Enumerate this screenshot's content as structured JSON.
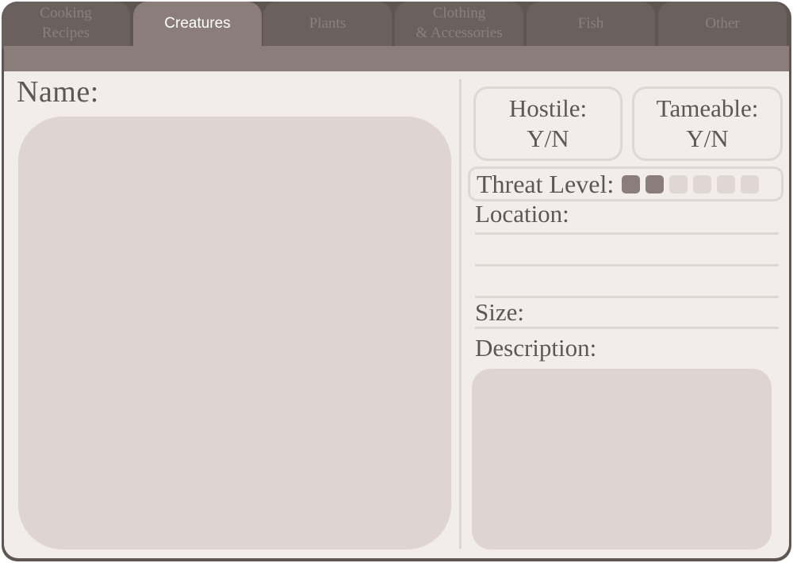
{
  "tabs": [
    {
      "label": "Cooking\nRecipes",
      "active": false
    },
    {
      "label": "Creatures",
      "active": true
    },
    {
      "label": "Plants",
      "active": false
    },
    {
      "label": "Clothing\n& Accessories",
      "active": false
    },
    {
      "label": "Fish",
      "active": false
    },
    {
      "label": "Other",
      "active": false
    }
  ],
  "form": {
    "name_label": "Name:",
    "hostile": {
      "label": "Hostile:",
      "value": "Y/N"
    },
    "tameable": {
      "label": "Tameable:",
      "value": "Y/N"
    },
    "threat": {
      "label": "Threat Level:",
      "level": 2,
      "max": 6
    },
    "location_label": "Location:",
    "size_label": "Size:",
    "description_label": "Description:"
  },
  "colors": {
    "frame": "#5f5654",
    "tab_active": "#8b7d7a",
    "panel": "#f2edea",
    "box": "#ded4d1",
    "pip_filled": "#8b7d7a",
    "pip_empty": "#e0d7d4"
  }
}
